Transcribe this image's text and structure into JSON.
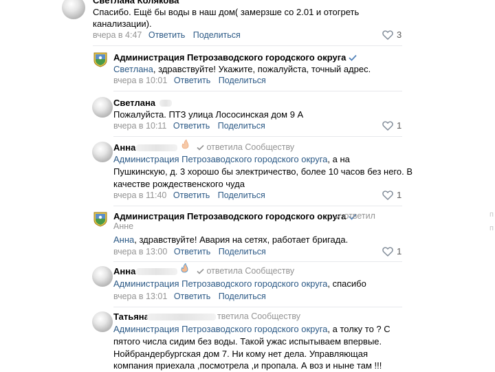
{
  "comments": [
    {
      "author": "Светлана Колякова",
      "text_lines": [
        "Спасибо. Ещё бы воды в наш дом( замерзше со 2.01 и отогреть",
        "канализации)."
      ],
      "time": "вчера в 4:47",
      "reply_label": "Ответить",
      "share_label": "Поделиться",
      "likes": "3"
    },
    {
      "author": "Администрация Петрозаводского городского округа",
      "verified": true,
      "mention": "Светлана",
      "text": ", здравствуйте! Укажите, пожалуйста, точный адрес.",
      "time": "вчера в 10:01",
      "reply_label": "Ответить",
      "share_label": "Поделиться"
    },
    {
      "author": "Светлана",
      "text": "Пожалуйста. ПТЗ улица Лососинская дом 9 А",
      "time": "вчера в 10:11",
      "reply_label": "Ответить",
      "share_label": "Поделиться",
      "likes": "1"
    },
    {
      "author": "Анна",
      "replied_to": "ответила Сообществу",
      "mention": "Администрация Петрозаводского городского округа",
      "text_first": ", а на",
      "text_lines": [
        "Пушкинскую, д. 3 хорошо бы электричество, более 10 часов без него. В",
        "качестве рождественского чуда"
      ],
      "time": "вчера в 11:40",
      "reply_label": "Ответить",
      "share_label": "Поделиться",
      "likes": "1"
    },
    {
      "author": "Администрация Петрозаводского городского округа",
      "verified": true,
      "replied_to": "ответил",
      "replied_to_name": "Анне",
      "mention": "Анна",
      "text": ", здравствуйте! Авария на сетях, работает бригада.",
      "time": "вчера в 13:00",
      "reply_label": "Ответить",
      "share_label": "Поделиться",
      "likes": "1"
    },
    {
      "author": "Анна",
      "replied_to": "ответила Сообществу",
      "mention": "Администрация Петрозаводского городского округа",
      "text": ", спасибо",
      "time": "вчера в 13:01",
      "reply_label": "Ответить",
      "share_label": "Поделиться"
    },
    {
      "author": "Татьяна",
      "replied_to": "тветила Сообществу",
      "mention": "Администрация Петрозаводского городского округа",
      "text_first": ", а толку то ? С",
      "text_lines": [
        "пятого числа сидим без воды. Такой ужас испытываем впервые.",
        "Нойбрандербургская дом 7. Ни кому нет дела. Управляющая",
        "компания приехала ,посмотрела ,и пропала. А воз и ныне там !!!"
      ]
    }
  ],
  "edge_marks": [
    "п",
    "п"
  ],
  "colors": {
    "link": "#2a5885",
    "meta": "#939393",
    "verified": "#5181b8",
    "separator": "#e7e8ec"
  }
}
